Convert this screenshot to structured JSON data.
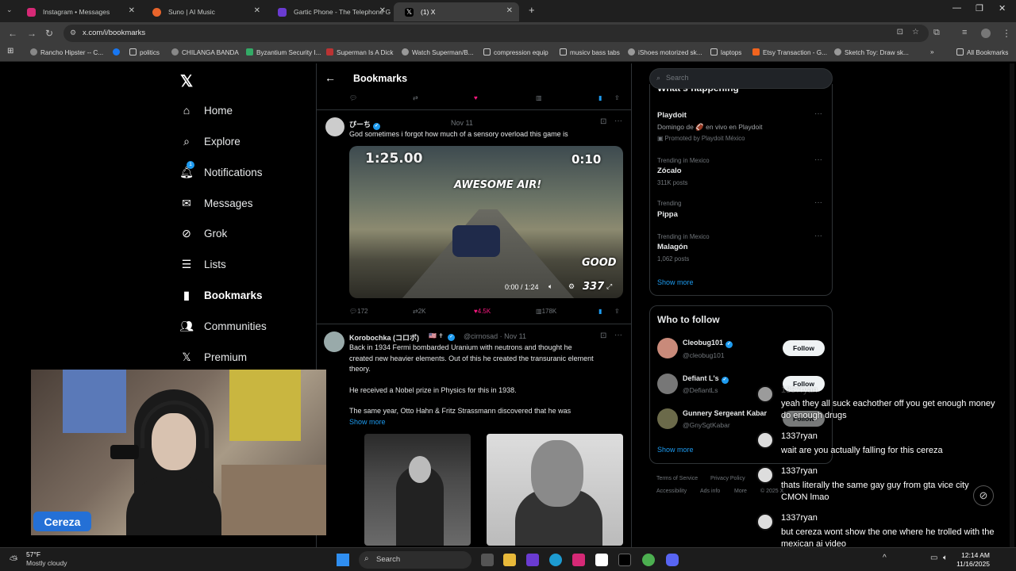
{
  "browser": {
    "tabs": [
      {
        "label": "Instagram • Messages",
        "color": "#d62976"
      },
      {
        "label": "Suno | AI Music",
        "color": "#e8642b"
      },
      {
        "label": "Gartic Phone - The Telephone G",
        "color": "#6a3bd1"
      },
      {
        "label": "(1) X",
        "color": "#000000"
      }
    ],
    "url": "x.com/i/bookmarks",
    "bookmarks": [
      "Rancho Hipster -- C...",
      "politics",
      "CHILANGA BANDA",
      "Byzantium Security I...",
      "Superman Is A Dick",
      "Watch Superman/B...",
      "compression equip",
      "musicv bass tabs",
      "iShoes motorized sk...",
      "laptops",
      "Etsy Transaction - G...",
      "Sketch Toy: Draw sk...",
      "All Bookmarks"
    ]
  },
  "nav": {
    "items": [
      {
        "label": "Home",
        "icon": "home-icon"
      },
      {
        "label": "Explore",
        "icon": "search-icon"
      },
      {
        "label": "Notifications",
        "icon": "bell-icon"
      },
      {
        "label": "Messages",
        "icon": "envelope-icon"
      },
      {
        "label": "Grok",
        "icon": "grok-icon"
      },
      {
        "label": "Lists",
        "icon": "list-icon"
      },
      {
        "label": "Bookmarks",
        "icon": "bookmark-icon"
      },
      {
        "label": "Communities",
        "icon": "people-icon"
      },
      {
        "label": "Premium",
        "icon": "x-icon"
      }
    ],
    "notification_count": "1"
  },
  "bookmarks": {
    "title": "Bookmarks",
    "tweets": [
      {
        "name": "ぴーち",
        "date": "Nov 11",
        "text": "God sometimes i forgot how much of a sensory overload this game is",
        "video": {
          "timer": "1:25.00",
          "lap": "0:10",
          "banner": "AWESOME AIR!",
          "rating": "GOOD",
          "counter": "337",
          "time": "0:00 / 1:24"
        },
        "replies": "172",
        "reposts": "2K",
        "likes": "4.5K",
        "views": "178K"
      },
      {
        "name": "Korobochka (コロボ)",
        "handle": "@cirnosad",
        "date": "Nov 11",
        "lines": [
          "Back in 1934 Fermi bombarded Uranium with neutrons and thought he",
          "created new heavier elements. Out of this he created the transuranic element",
          "theory.",
          "He received a Nobel prize in Physics for this in 1938.",
          "The same year, Otto Hahn & Fritz Strassmann discovered that he was"
        ],
        "show_more": "Show more"
      }
    ]
  },
  "right": {
    "search_placeholder": "Search",
    "happening_title": "What's happening",
    "trends": [
      {
        "meta": "",
        "name": "Playdoit",
        "sub": "Domingo de 🏈 en vivo en Playdoit",
        "promo": "Promoted by Playdoit México"
      },
      {
        "meta": "Trending in Mexico",
        "name": "Zócalo",
        "sub": "311K posts"
      },
      {
        "meta": "Trending",
        "name": "Pippa",
        "sub": ""
      },
      {
        "meta": "Trending in Mexico",
        "name": "Malagón",
        "sub": "1,062 posts"
      }
    ],
    "show_more": "Show more",
    "wtf_title": "Who to follow",
    "follow_label": "Follow",
    "suggestions": [
      {
        "name": "Cleobug101",
        "handle": "@cleobug101"
      },
      {
        "name": "Defiant L's",
        "handle": "@DefiantLs"
      },
      {
        "name": "Gunnery Sergeant Kabar",
        "handle": "@GnySgtKabar"
      }
    ],
    "footer": [
      "Terms of Service",
      "Privacy Policy",
      "Accessibility",
      "Ads info",
      "More",
      "© 2025 X"
    ]
  },
  "stream": {
    "cam_name": "Cereza",
    "chat": [
      {
        "user": "1337ryan",
        "msg": "yeah they all suck eachother off you get enough money do enough drugs"
      },
      {
        "user": "1337ryan",
        "msg": "wait are you actually falling for this cereza"
      },
      {
        "user": "1337ryan",
        "msg": "thats literally the same gay guy from gta vice city CMON lmao"
      },
      {
        "user": "1337ryan",
        "msg": "but cereza wont show the one where he trolled with the mexican ai video"
      }
    ]
  },
  "taskbar": {
    "temp": "57°F",
    "weather": "Mostly cloudy",
    "search": "Search",
    "time": "12:14 AM",
    "date": "11/16/2025"
  }
}
